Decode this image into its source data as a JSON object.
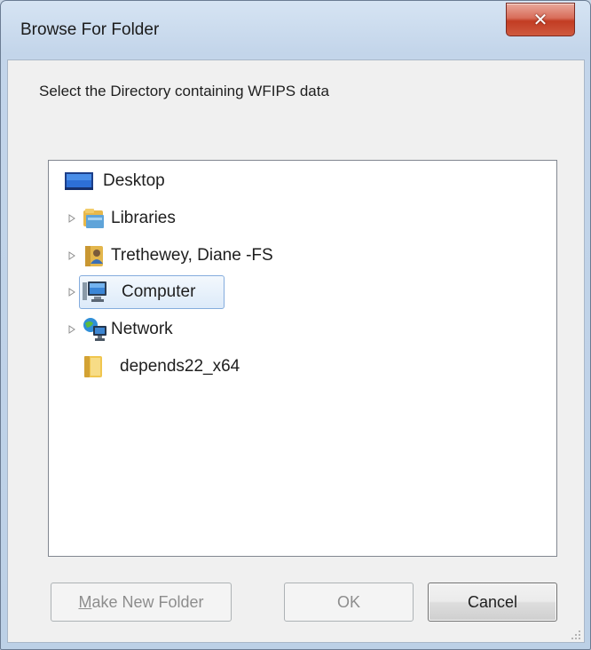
{
  "window": {
    "title": "Browse For Folder",
    "close_icon": "close-icon"
  },
  "prompt": "Select the Directory containing WFIPS data",
  "tree": {
    "items": [
      {
        "label": "Desktop",
        "icon": "desktop-icon",
        "expandable": false,
        "selected": false
      },
      {
        "label": "Libraries",
        "icon": "libraries-icon",
        "expandable": true,
        "selected": false
      },
      {
        "label": "Trethewey, Diane -FS",
        "icon": "user-folder-icon",
        "expandable": true,
        "selected": false
      },
      {
        "label": "Computer",
        "icon": "computer-icon",
        "expandable": true,
        "selected": true
      },
      {
        "label": "Network",
        "icon": "network-icon",
        "expandable": true,
        "selected": false
      },
      {
        "label": "depends22_x64",
        "icon": "folder-icon",
        "expandable": false,
        "selected": false
      }
    ]
  },
  "buttons": {
    "make_new_folder_mnemonic": "M",
    "make_new_folder_rest": "ake New Folder",
    "ok": "OK",
    "cancel": "Cancel"
  },
  "colors": {
    "selection_border": "#84acdd",
    "close_button": "#c23c23",
    "frame": "#c3d5ea"
  }
}
